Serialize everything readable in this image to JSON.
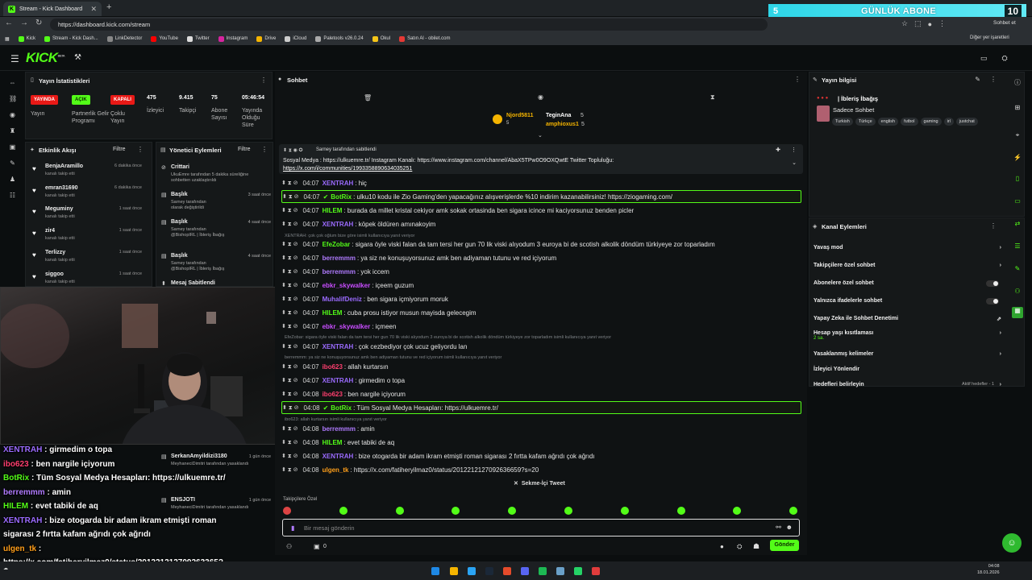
{
  "browser": {
    "tab_title": "Stream - Kick Dashboard",
    "url": "https://dashboard.kick.com/stream",
    "bookmarks": [
      "Kick",
      "Stream - Kick Dash...",
      "LinkDetector",
      "YouTube",
      "Twitter",
      "Instagram",
      "Drive",
      "iCloud",
      "Paletools v26.0.24",
      "Okul",
      "Satın Al - obilet.com"
    ],
    "bookmarks_right": "Diğer yer işaretleri",
    "profile_label": "Sohbet et"
  },
  "sub_banner": {
    "count_left": "5",
    "text": "GÜNLÜK ABONE",
    "count_right": "10"
  },
  "colors": {
    "kick_green": "#53fc18",
    "live_red": "#e91916",
    "banner_cyan": "#2ed6e8"
  },
  "header": {
    "logo": "KICK",
    "logo_tag": "BETA"
  },
  "stats": {
    "title": "Yayın İstatistikleri",
    "items": [
      {
        "badge": "YAYINDA",
        "label": "Yayın"
      },
      {
        "badge": "AÇIK",
        "label": "Partnerlik Gelir Programı"
      },
      {
        "badge": "KAPALI",
        "label": "Çoklu Yayın"
      },
      {
        "value": "475",
        "label": "İzleyici"
      },
      {
        "value": "9.415",
        "label": "Takipçi"
      },
      {
        "value": "75",
        "label": "Abone Sayısı"
      },
      {
        "value": "05:46:54",
        "label": "Yayında Olduğu Süre"
      }
    ]
  },
  "activity": {
    "title": "Etkinlik Akışı",
    "filter": "Filtre",
    "events": [
      {
        "name": "BenjaAramillo",
        "sub": "kanalı takip etti",
        "time": "6 dakika önce"
      },
      {
        "name": "emran31690",
        "sub": "kanalı takip etti",
        "time": "6 dakika önce"
      },
      {
        "name": "Meguminy",
        "sub": "kanalı takip etti",
        "time": "1 saat önce"
      },
      {
        "name": "zir4",
        "sub": "kanalı takip etti",
        "time": "1 saat önce"
      },
      {
        "name": "Terlizzy",
        "sub": "kanalı takip etti",
        "time": "1 saat önce"
      },
      {
        "name": "siggoo",
        "sub": "kanalı takip etti",
        "time": "1 saat önce"
      }
    ]
  },
  "mod": {
    "title": "Yönetici Eylemleri",
    "filter": "Filtre",
    "items": [
      {
        "title": "Crittari",
        "line1": "UkuEmre tarafından 5 dakika süreliğine",
        "line2": "sohbetten uzaklaştırıldı",
        "time": ""
      },
      {
        "title": "Başlık",
        "line1": "Sarney tarafından",
        "line2": "olarak değiştirildi",
        "time": "3 saat önce"
      },
      {
        "title": "Başlık",
        "line1": "Sarney tarafından",
        "line2": "@BishopIRL | İbleriş İbağış",
        "time": "4 saat önce"
      },
      {
        "title": "Başlık",
        "line1": "Sarney tarafından",
        "line2": "@BishopIRL | İbleriş İbağış",
        "time": "4 saat önce"
      },
      {
        "title": "Mesaj Sabitlendi",
        "line1": "",
        "line2": "",
        "time": ""
      },
      {
        "title": "SerkanAmyildizi3180",
        "line1": "MeyhaneciDimitri tarafından yasaklandı",
        "line2": "",
        "time": "1 gün önce"
      },
      {
        "title": "ENSJOTI",
        "line1": "MeyhaneciDimitri tarafından yasaklandı",
        "line2": "",
        "time": "1 gün önce"
      }
    ]
  },
  "overlay": [
    {
      "name": "XENTRAH",
      "text": " : girmedim o topa",
      "color": "#9b6bff"
    },
    {
      "name": "ibo623",
      "text": " : ben nargile içiyorum",
      "color": "#ff3f6f"
    },
    {
      "name": "BotRix",
      "text": " : Tüm Sosyal Medya Hesapları: https://ulkuemre.tr/",
      "color": "#53fc18"
    },
    {
      "name": "berremmm",
      "text": " : amin",
      "color": "#b07bff"
    },
    {
      "name": "HILEM",
      "text": " : evet tabiki de aq",
      "color": "#53fc18"
    },
    {
      "name": "XENTRAH",
      "text": " : bize otogarda bir adam ikram etmişti roman",
      "color": "#9b6bff"
    },
    {
      "name": "",
      "text": "sigarası 2 fırtta kafam ağrıdı çok ağrıdı",
      "color": "#fff"
    },
    {
      "name": "ulgen_tk",
      "text": " :",
      "color": "#ff9f1a"
    },
    {
      "name": "",
      "text": "https://x.com/fatiheryilmaz0/status/201221212709263365?",
      "color": "#fff"
    }
  ],
  "chat": {
    "title": "Sohbet",
    "top_users": [
      {
        "name": "Njord5811",
        "count": "5"
      },
      {
        "name": "TeginAna",
        "count": "5"
      },
      {
        "name": "amphioxus1",
        "count": "5"
      }
    ],
    "pinned_by": "Sarney tarafından sabitlendi",
    "pinned_text1": "Sosyal Medya : https://ulkuemre.tr/ Instagram Kanalı: https://www.instagram.com/channel/AbaX5TPw0O9OXQwtE Twitter Topluluğu:",
    "pinned_text2": "https://x.com/i/communities/1993358890634035251",
    "messages": [
      {
        "time": "04:07",
        "name": "XENTRAH",
        "color": "#9b6bff",
        "text": ": hiç",
        "hl": false
      },
      {
        "time": "04:07",
        "name": "BotRix",
        "color": "#53fc18",
        "text": ": ulku10 kodu ile Zio Gaming'den yapacağınız alışverişlerde %10 indirim kazanabilirsiniz! https://ziogaming.com/",
        "hl": true
      },
      {
        "time": "04:07",
        "name": "HILEM",
        "color": "#53fc18",
        "text": ": burada da millet kristal cekiyor amk sokak ortasinda ben sigara icince mi kaciyorsunuz benden picler",
        "hl": false
      },
      {
        "time": "04:07",
        "name": "XENTRAH",
        "color": "#9b6bff",
        "text": ": köpek öldüren amınakoyim",
        "hl": false
      },
      {
        "time": "04:07",
        "name": "EfeZobar",
        "color": "#53fc18",
        "text": ": sigara öyle viski falan da tam tersi her gun 70 lik viski alıyodum 3 euroya bi de scotish alkolik döndüm türkiyeye zor toparladım",
        "hl": false
      },
      {
        "time": "04:07",
        "name": "berremmm",
        "color": "#b07bff",
        "text": ": ya siz ne konuşuyorsunuz amk ben adiyaman tutunu ve red içiyorum",
        "hl": false
      },
      {
        "time": "04:07",
        "name": "berremmm",
        "color": "#b07bff",
        "text": ": yok iccem",
        "hl": false
      },
      {
        "time": "04:07",
        "name": "ebkr_skywalker",
        "color": "#c84dff",
        "text": ": içeem guzum",
        "hl": false
      },
      {
        "time": "04:07",
        "name": "MuhalifDeniz",
        "color": "#9b6bff",
        "text": ": ben sigara içmiyorum moruk",
        "hl": false
      },
      {
        "time": "04:07",
        "name": "HILEM",
        "color": "#53fc18",
        "text": ": cuba prosu istiyor musun mayisda gelecegim",
        "hl": false
      },
      {
        "time": "04:07",
        "name": "ebkr_skywalker",
        "color": "#c84dff",
        "text": ": içmeen",
        "hl": false
      },
      {
        "time": "04:07",
        "name": "XENTRAH",
        "color": "#9b6bff",
        "text": ": çok cezbediyor çok ucuz geliyordu lan",
        "hl": false
      },
      {
        "time": "04:07",
        "name": "ibo623",
        "color": "#ff3f6f",
        "text": ": allah kurtarsın",
        "hl": false
      },
      {
        "time": "04:07",
        "name": "XENTRAH",
        "color": "#9b6bff",
        "text": ": girmedim o topa",
        "hl": false
      },
      {
        "time": "04:08",
        "name": "ibo623",
        "color": "#ff3f6f",
        "text": ": ben nargile içiyorum",
        "hl": false
      },
      {
        "time": "04:08",
        "name": "BotRix",
        "color": "#53fc18",
        "text": ": Tüm Sosyal Medya Hesapları: https://ulkuemre.tr/",
        "hl": true
      },
      {
        "time": "04:08",
        "name": "berremmm",
        "color": "#b07bff",
        "text": ": amin",
        "hl": false
      },
      {
        "time": "04:08",
        "name": "HILEM",
        "color": "#53fc18",
        "text": ": evet tabiki de aq",
        "hl": false
      },
      {
        "time": "04:08",
        "name": "XENTRAH",
        "color": "#9b6bff",
        "text": ": bize otogarda bir adam ikram etmişti roman sigarası 2 fırtta kafam ağrıdı çok ağrıdı",
        "hl": false
      },
      {
        "time": "04:08",
        "name": "ulgen_tk",
        "color": "#ff9f1a",
        "text": ": https://x.com/fatiheryilmaz0/status/2012212127092636659?s=20",
        "hl": false
      }
    ],
    "sys_notes": [
      "XENTRAH: çok çok oğlum bize göre isimli kullanıcıya yanıt veriyor",
      "EfeZobar: sigara öyle viski falan da tam tersi her gun 70 lik viski alıyodum 3 euroya bi de scotish alkolik döndüm türkiyeye zor toparladım isimli kullanıcıya yanıt veriyor",
      "berremmm: ya siz ne konuşuyorsunuz amk ben adiyaman tutunu ve red içiyorum isimli kullanıcıya yanıt veriyor",
      "ibo623: allah kurtarsın isimli kullanıcıya yanıt veriyor"
    ],
    "tweet_tab": "Sekme-İçi Tweet",
    "followers_label": "Takipçilere Özel",
    "input_placeholder": "Bir mesaj gönderin",
    "send_label": "Gönder",
    "count_zero": "0"
  },
  "info": {
    "title": "Yayın bilgisi",
    "stream_title": "| İbleriş İbağış",
    "category": "Sadece Sohbet",
    "tags": [
      "Turkish",
      "Türkçe",
      "english",
      "futbol",
      "gaming",
      "irl",
      "justchat"
    ]
  },
  "channel_actions": {
    "title": "Kanal Eylemleri",
    "items": [
      {
        "label": "Yavaş mod",
        "type": "chevron",
        "sub": ""
      },
      {
        "label": "Takipçilere özel sohbet",
        "type": "chevron",
        "sub": ""
      },
      {
        "label": "Abonelere özel sohbet",
        "type": "toggle",
        "sub": ""
      },
      {
        "label": "Yalnızca ifadelerle sohbet",
        "type": "toggle",
        "sub": ""
      },
      {
        "label": "Yapay Zeka ile Sohbet Denetimi",
        "type": "ext",
        "sub": ""
      },
      {
        "label": "Hesap yaşı kısıtlaması",
        "type": "chevron",
        "sub": "2 sa."
      },
      {
        "label": "Yasaklanmış kelimeler",
        "type": "chevron",
        "sub": ""
      },
      {
        "label": "İzleyici Yönlendir",
        "type": "none",
        "sub": ""
      },
      {
        "label": "Hedefleri belirleyin",
        "type": "goal",
        "sub": "Aktif hedefler - 1"
      }
    ]
  },
  "taskbar": {
    "time": "04:08",
    "date": "18.01.2026"
  }
}
